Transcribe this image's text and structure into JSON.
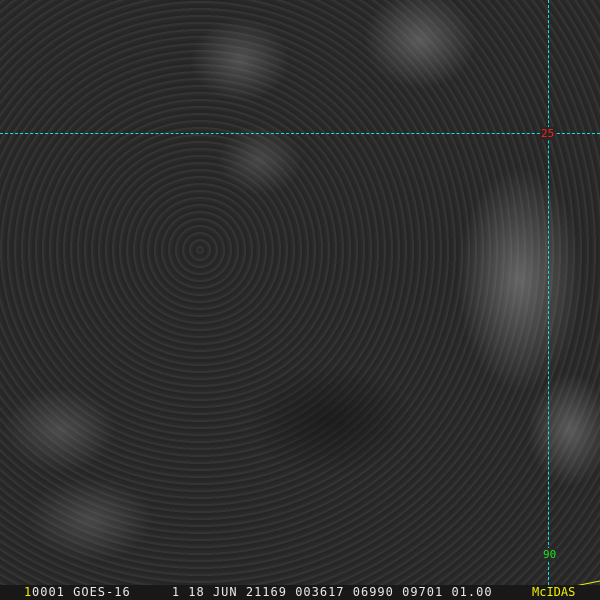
{
  "overlay": {
    "lat_label": "25",
    "lon_label": "90",
    "grid_color": "#17e0e6"
  },
  "status_bar": {
    "frame_number": "1",
    "info": "0001 GOES-16     1 18 JUN 21169 003617 06990 09701 01.00",
    "brand": "McIDAS"
  }
}
